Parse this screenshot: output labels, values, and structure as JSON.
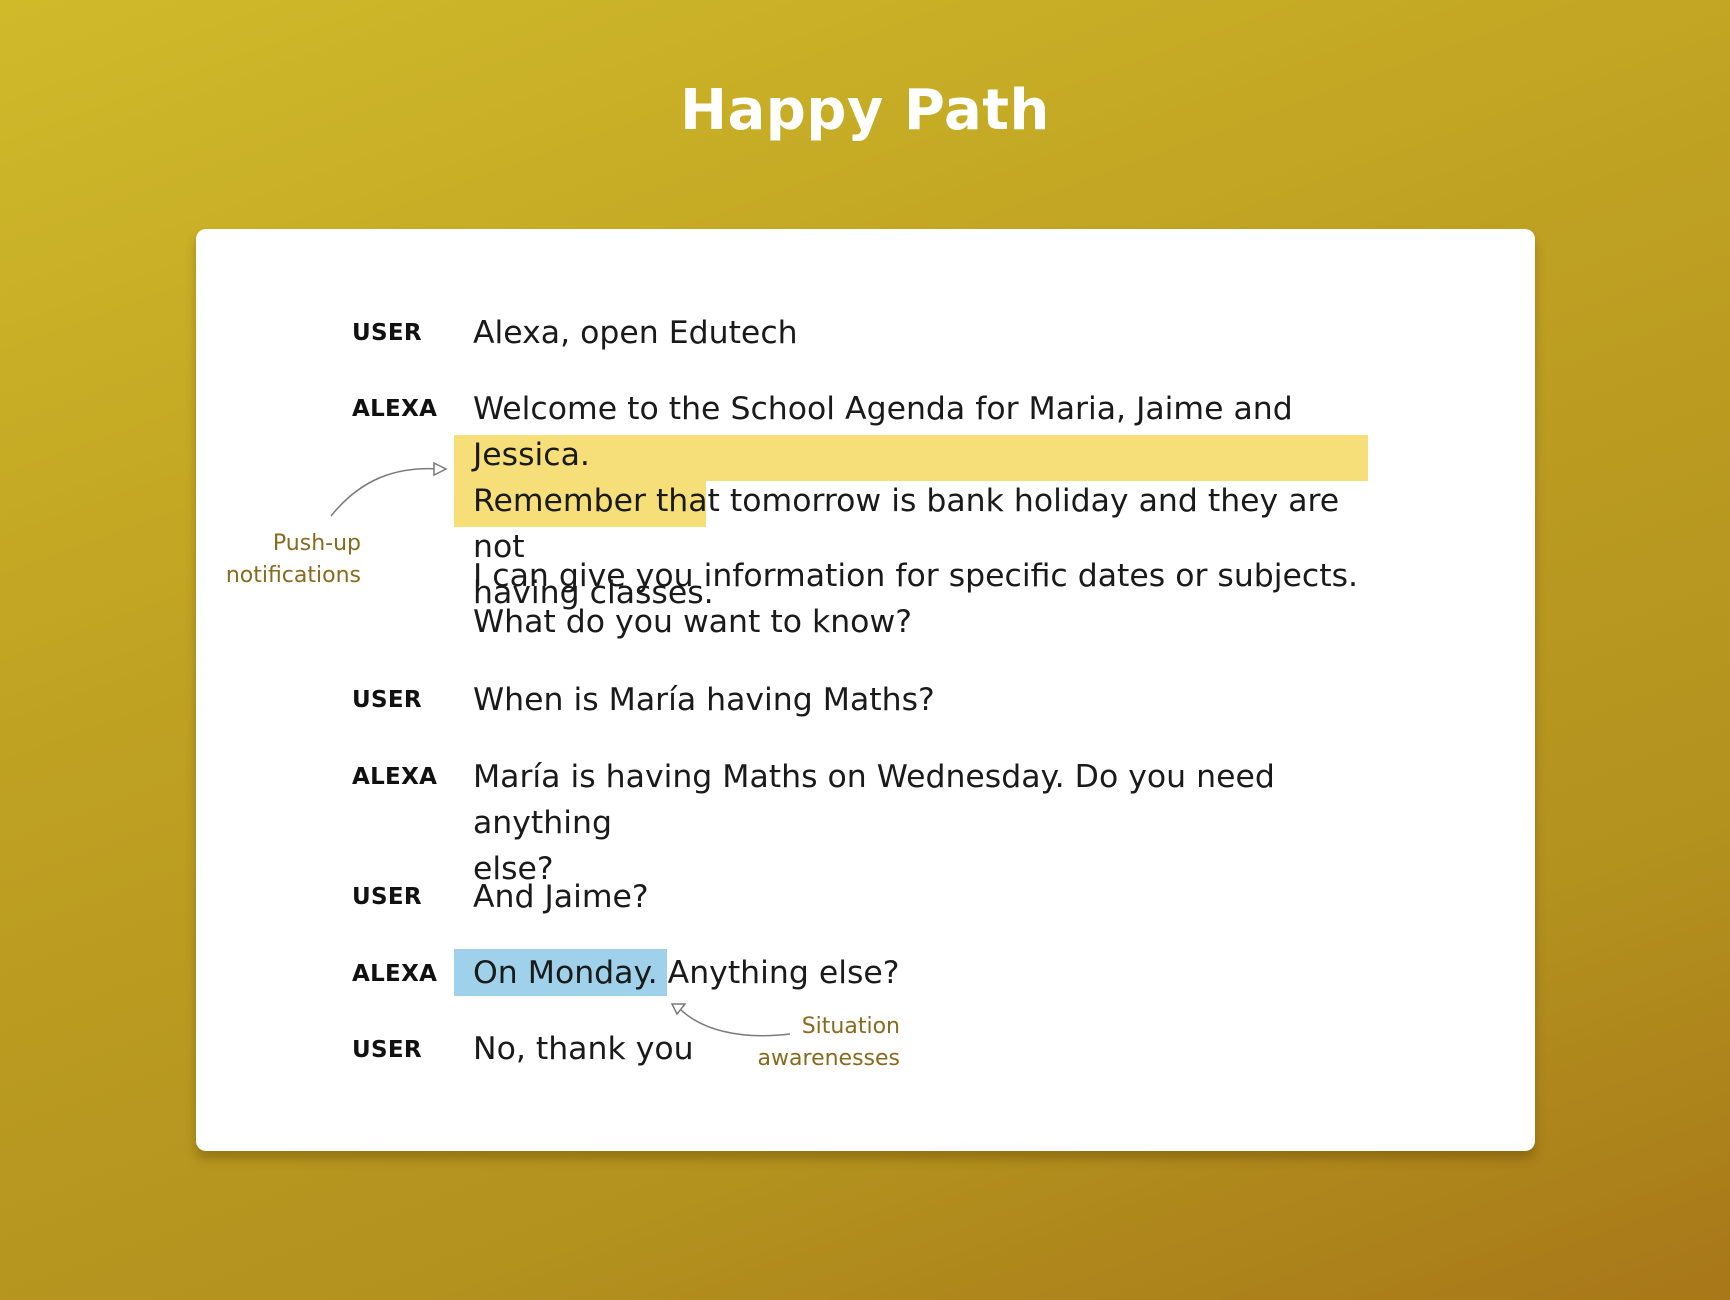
{
  "title": "Happy Path",
  "conversation": [
    {
      "speaker": "USER",
      "text": "Alexa, open Edutech"
    },
    {
      "speaker": "ALEXA",
      "text_lines": [
        "Welcome to the School Agenda for Maria, Jaime and Jessica."
      ],
      "highlight_lines": [
        "Remember that tomorrow is bank holiday and they are not",
        "having classes."
      ]
    },
    {
      "speaker": "",
      "text_lines": [
        "I can give you information for specific dates or subjects.",
        "What do you want to know?"
      ]
    },
    {
      "speaker": "USER",
      "text": "When is María having Maths?"
    },
    {
      "speaker": "ALEXA",
      "text_lines": [
        "María is having Maths on Wednesday. Do you need anything",
        "else?"
      ]
    },
    {
      "speaker": "USER",
      "text": "And Jaime?"
    },
    {
      "speaker": "ALEXA",
      "highlight": "On Monday.",
      "rest": " Anything else?"
    },
    {
      "speaker": "USER",
      "text": "No, thank you"
    }
  ],
  "annotations": {
    "push_up": [
      "Push-up",
      "notifications"
    ],
    "situation": [
      "Situation",
      "awarenesses"
    ]
  },
  "colors": {
    "notification_highlight": "#f6df78",
    "situation_highlight": "#9fd2ea",
    "annotation_text": "#8a6a1e"
  }
}
